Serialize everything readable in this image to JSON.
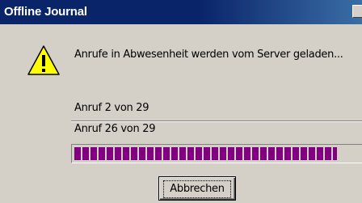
{
  "window": {
    "title": "Offline Journal"
  },
  "message": {
    "icon": "warning-icon",
    "text": "Anrufe in Abwesenheit werden vom Server geladen..."
  },
  "status": {
    "line1": "Anruf 2 von 29",
    "line2": "Anruf 26 von 29"
  },
  "progress": {
    "value": 26,
    "max": 29,
    "fill_color": "#80007f"
  },
  "buttons": {
    "cancel_label": "Abbrechen"
  },
  "colors": {
    "titlebar": "#0a246a",
    "face": "#d4d0c8",
    "warning_yellow": "#ffff00"
  }
}
